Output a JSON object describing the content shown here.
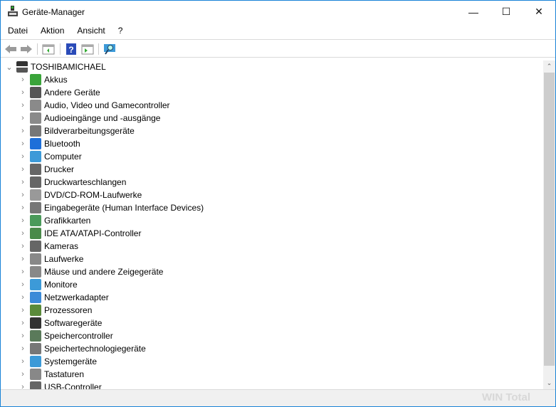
{
  "window": {
    "title": "Geräte-Manager",
    "minimize": "—",
    "maximize": "☐",
    "close": "✕"
  },
  "menu": [
    "Datei",
    "Aktion",
    "Ansicht",
    "?"
  ],
  "toolbar": [
    "back",
    "forward",
    "properties",
    "help",
    "update-driver",
    "scan-hardware"
  ],
  "tree": {
    "root": "TOSHIBAMICHAEL",
    "items": [
      {
        "label": "Akkus",
        "color": "#3aa43a"
      },
      {
        "label": "Andere Geräte",
        "color": "#555555"
      },
      {
        "label": "Audio, Video und Gamecontroller",
        "color": "#8a8a8a"
      },
      {
        "label": "Audioeingänge und -ausgänge",
        "color": "#8a8a8a"
      },
      {
        "label": "Bildverarbeitungsgeräte",
        "color": "#777777"
      },
      {
        "label": "Bluetooth",
        "color": "#1e6fd9"
      },
      {
        "label": "Computer",
        "color": "#3c9ad8"
      },
      {
        "label": "Drucker",
        "color": "#666666"
      },
      {
        "label": "Druckwarteschlangen",
        "color": "#666666"
      },
      {
        "label": "DVD/CD-ROM-Laufwerke",
        "color": "#999999"
      },
      {
        "label": "Eingabegeräte (Human Interface Devices)",
        "color": "#777777"
      },
      {
        "label": "Grafikkarten",
        "color": "#4a9a5a"
      },
      {
        "label": "IDE ATA/ATAPI-Controller",
        "color": "#4a8a4a"
      },
      {
        "label": "Kameras",
        "color": "#666666"
      },
      {
        "label": "Laufwerke",
        "color": "#888888"
      },
      {
        "label": "Mäuse und andere Zeigegeräte",
        "color": "#888888"
      },
      {
        "label": "Monitore",
        "color": "#3c9ad8"
      },
      {
        "label": "Netzwerkadapter",
        "color": "#3c8ad8"
      },
      {
        "label": "Prozessoren",
        "color": "#5a8a3a"
      },
      {
        "label": "Softwaregeräte",
        "color": "#333333"
      },
      {
        "label": "Speichercontroller",
        "color": "#5a7a5a"
      },
      {
        "label": "Speichertechnologiegeräte",
        "color": "#777777"
      },
      {
        "label": "Systemgeräte",
        "color": "#3c9ad8"
      },
      {
        "label": "Tastaturen",
        "color": "#888888"
      },
      {
        "label": "USB-Controller",
        "color": "#666666"
      }
    ]
  },
  "watermark": "WINTotal"
}
